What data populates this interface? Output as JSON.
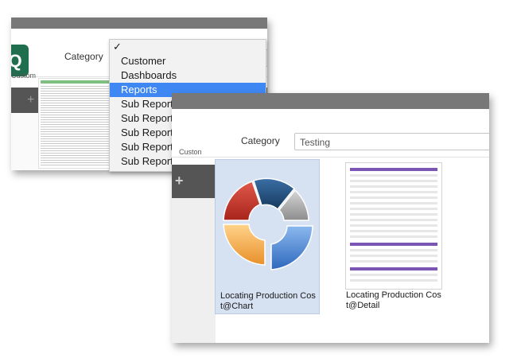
{
  "back_window": {
    "category_label": "Category",
    "logo_caption": "Custom",
    "dropdown": {
      "check_mark": "✓",
      "items": [
        {
          "label": "Customer"
        },
        {
          "label": "Dashboards"
        },
        {
          "label": "Reports",
          "selected": true
        },
        {
          "label": "Sub Reports"
        },
        {
          "label": "Sub Reports"
        },
        {
          "label": "Sub Reports"
        },
        {
          "label": "Sub Reports"
        },
        {
          "label": "Sub Reports"
        }
      ]
    }
  },
  "front_window": {
    "category_label": "Category",
    "category_value": "Testing",
    "logo_caption": "Custon",
    "toolbar_icon": "plus-icon",
    "tiles": [
      {
        "label": "Locating Production Cost@Chart",
        "icon": "pie-chart-icon",
        "selected": true
      },
      {
        "label": "Locating Production Cost@Detail",
        "icon": "report-thumbnail"
      }
    ]
  },
  "colors": {
    "selection_blue": "#3f88f3",
    "tile_selected_bg": "#d6e1f1",
    "toolbar_gray": "#555555",
    "logo_green": "#1f6e4e",
    "chart_red": "#c9372c",
    "chart_navy": "#1f4e79",
    "chart_silver": "#a9a9a9",
    "chart_orange": "#f0a340",
    "chart_blue": "#3e7fd1",
    "detail_band_purple": "#7a55b4"
  }
}
